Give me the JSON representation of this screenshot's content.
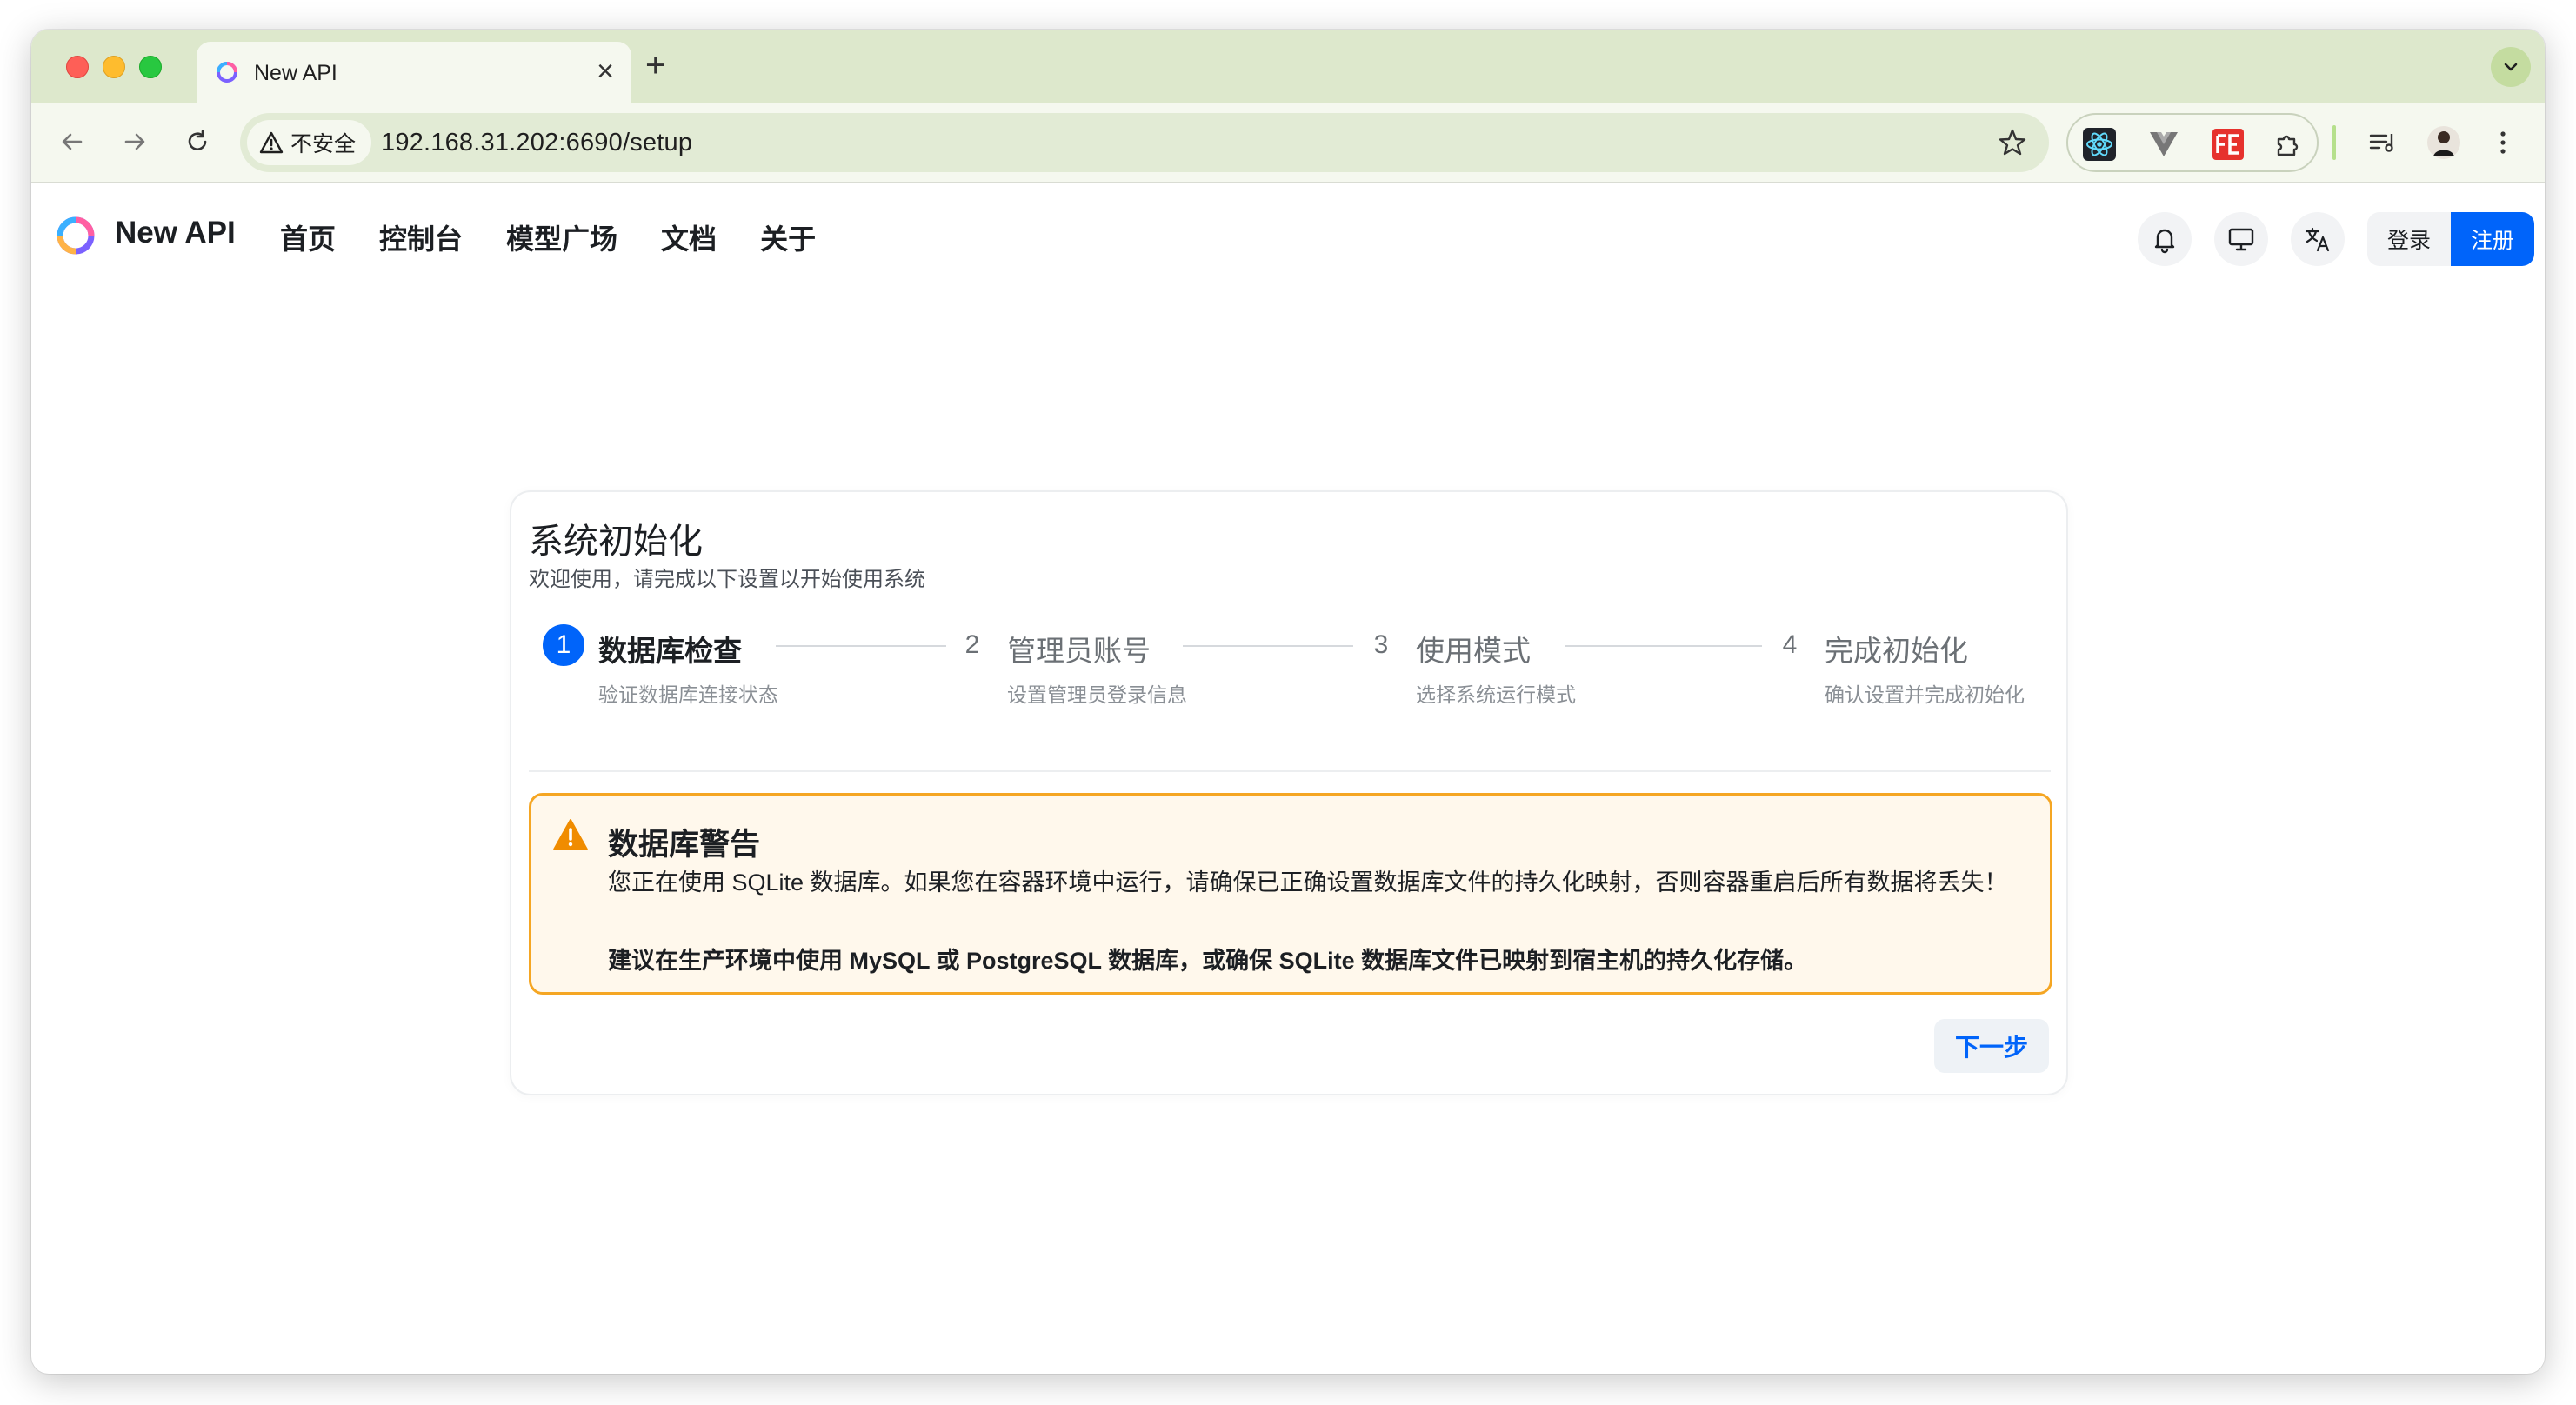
{
  "browser": {
    "tab_title": "New API",
    "new_tab_symbol": "+",
    "close_symbol": "×",
    "security_label": "不安全",
    "url": "192.168.31.202:6690/setup"
  },
  "header": {
    "brand": "New API",
    "nav": [
      "首页",
      "控制台",
      "模型广场",
      "文档",
      "关于"
    ],
    "login": "登录",
    "register": "注册",
    "accent_color": "#0064fa"
  },
  "setup": {
    "title": "系统初始化",
    "subtitle": "欢迎使用，请完成以下设置以开始使用系统",
    "steps": [
      {
        "num": "1",
        "title": "数据库检查",
        "desc": "验证数据库连接状态"
      },
      {
        "num": "2",
        "title": "管理员账号",
        "desc": "设置管理员登录信息"
      },
      {
        "num": "3",
        "title": "使用模式",
        "desc": "选择系统运行模式"
      },
      {
        "num": "4",
        "title": "完成初始化",
        "desc": "确认设置并完成初始化"
      }
    ],
    "current_step": 1,
    "warning": {
      "title": "数据库警告",
      "text": "您正在使用 SQLite 数据库。如果您在容器环境中运行，请确保已正确设置数据库文件的持久化映射，否则容器重启后所有数据将丢失！",
      "recommend": "建议在生产环境中使用 MySQL 或 PostgreSQL 数据库，或确保 SQLite 数据库文件已映射到宿主机的持久化存储。",
      "color": "#f5a623"
    },
    "next": "下一步"
  }
}
